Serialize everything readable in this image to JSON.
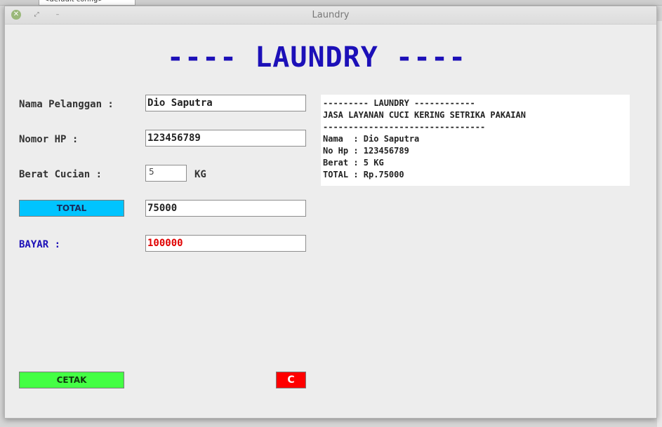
{
  "window": {
    "title": "Laundry",
    "close_icon": "close-icon",
    "restore_icon": "restore-icon",
    "minimize_icon": "minimize-icon"
  },
  "background": {
    "config_combo": "<default config>"
  },
  "heading": "---- LAUNDRY ----",
  "form": {
    "name_label": "Nama Pelanggan :",
    "name_value": "Dio Saputra",
    "phone_label": "Nomor HP :",
    "phone_value": "123456789",
    "weight_label": "Berat Cucian :",
    "weight_value": "5",
    "weight_unit": "KG",
    "total_button": "TOTAL",
    "total_value": "75000",
    "pay_label": "BAYAR :",
    "pay_value": "100000"
  },
  "receipt": {
    "lines": [
      "--------- LAUNDRY ------------",
      "JASA LAYANAN CUCI KERING SETRIKA PAKAIAN",
      "--------------------------------",
      "Nama  : Dio Saputra",
      "No Hp : 123456789",
      "Berat : 5 KG",
      "TOTAL : Rp.75000"
    ]
  },
  "buttons": {
    "print": "CETAK",
    "clear": "C"
  },
  "colors": {
    "heading": "#1c10b8",
    "pay_label": "#1c10b8",
    "pay_value": "#e00000",
    "total_button": "#00c4ff",
    "print_button": "#44ff44",
    "clear_button": "#ff0000"
  }
}
